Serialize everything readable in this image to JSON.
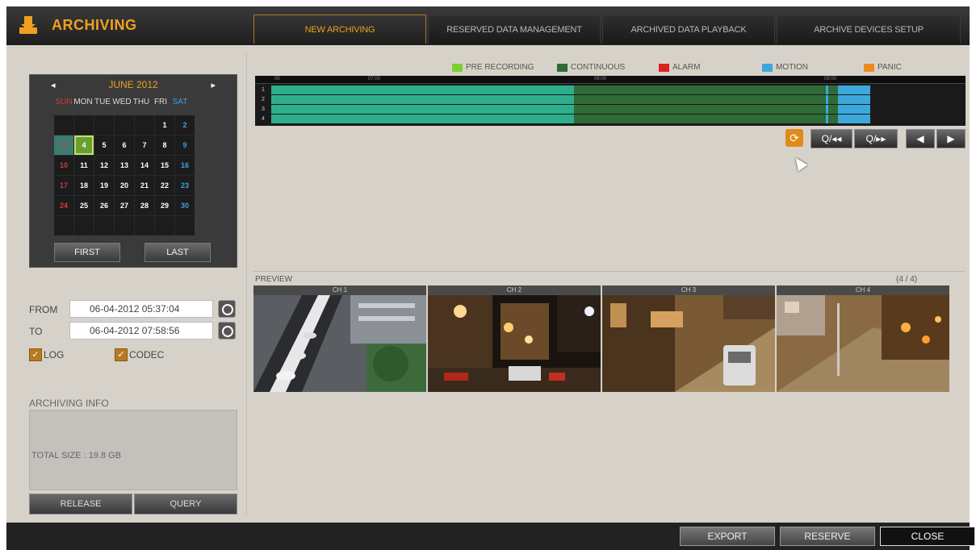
{
  "header": {
    "title": "ARCHIVING",
    "tabs": [
      {
        "label": "NEW ARCHIVING"
      },
      {
        "label": "RESERVED DATA MANAGEMENT"
      },
      {
        "label": "ARCHIVED DATA PLAYBACK"
      },
      {
        "label": "ARCHIVE DEVICES SETUP"
      }
    ]
  },
  "calendar": {
    "month": "JUNE 2012",
    "days": [
      "SUN",
      "MON",
      "TUE",
      "WED",
      "THU",
      "FRI",
      "SAT"
    ],
    "first_label": "FIRST",
    "last_label": "LAST"
  },
  "range": {
    "from_label": "FROM",
    "from_value": "06-04-2012 05:37:04",
    "to_label": "TO",
    "to_value": "06-04-2012 07:58:56"
  },
  "options": {
    "log_label": "LOG",
    "codec_label": "CODEC"
  },
  "archiving_info": {
    "title": "ARCHIVING INFO",
    "total_size": "TOTAL SIZE : 19.8 GB",
    "release_label": "RELEASE",
    "query_label": "QUERY"
  },
  "legend": [
    {
      "label": "PRE RECORDING",
      "color": "#7ad030"
    },
    {
      "label": "CONTINUOUS",
      "color": "#2e6b36"
    },
    {
      "label": "ALARM",
      "color": "#e02020"
    },
    {
      "label": "MOTION",
      "color": "#3ca8dc"
    },
    {
      "label": "PANIC",
      "color": "#f08a20"
    }
  ],
  "timeline": {
    "ruler": [
      "00",
      "07:00",
      "08:00",
      "09:00"
    ],
    "channels": [
      "1",
      "2",
      "3",
      "4"
    ]
  },
  "controls": {
    "zoom_out": "Q/◂◂",
    "zoom_in": "Q/▸▸",
    "prev": "◀",
    "next": "▶"
  },
  "preview": {
    "label": "PREVIEW",
    "count": "(4 / 4)",
    "channels": [
      "CH 1",
      "CH 2",
      "CH 3",
      "CH 4"
    ]
  },
  "footer": {
    "export_label": "EXPORT",
    "reserve_label": "RESERVE",
    "close_label": "CLOSE"
  }
}
